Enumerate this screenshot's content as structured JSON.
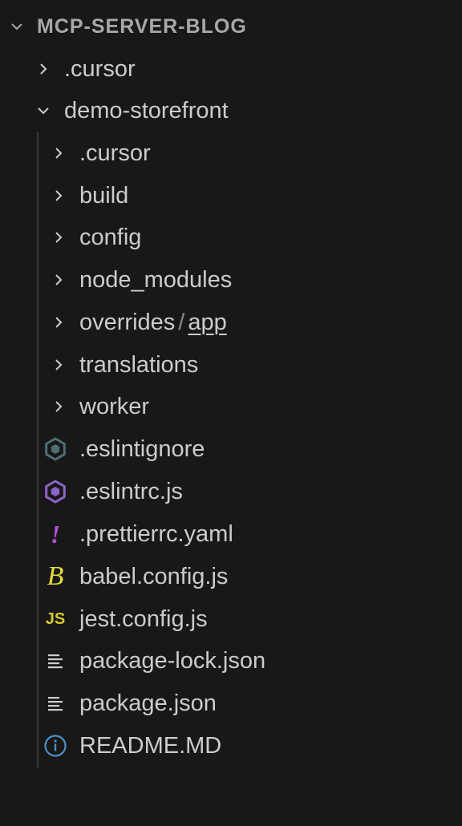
{
  "explorer": {
    "root": {
      "title": "MCP-SERVER-BLOG",
      "expanded": true
    },
    "items": [
      {
        "label": ".cursor",
        "type": "folder",
        "expanded": false
      },
      {
        "label": "demo-storefront",
        "type": "folder",
        "expanded": true
      }
    ],
    "children": [
      {
        "label": ".cursor",
        "type": "folder",
        "expanded": false
      },
      {
        "label": "build",
        "type": "folder",
        "expanded": false
      },
      {
        "label": "config",
        "type": "folder",
        "expanded": false
      },
      {
        "label": "node_modules",
        "type": "folder",
        "expanded": false
      },
      {
        "label": "overrides",
        "label_sep": "/",
        "label_suffix": "app",
        "type": "folder",
        "expanded": false
      },
      {
        "label": "translations",
        "type": "folder",
        "expanded": false
      },
      {
        "label": "worker",
        "type": "folder",
        "expanded": false
      },
      {
        "label": ".eslintignore",
        "type": "file",
        "icon": "eslint-ignore-icon"
      },
      {
        "label": ".eslintrc.js",
        "type": "file",
        "icon": "eslint-icon"
      },
      {
        "label": ".prettierrc.yaml",
        "type": "file",
        "icon": "prettier-icon",
        "glyph": "!"
      },
      {
        "label": "babel.config.js",
        "type": "file",
        "icon": "babel-icon",
        "glyph": "B"
      },
      {
        "label": "jest.config.js",
        "type": "file",
        "icon": "js-icon",
        "glyph": "JS"
      },
      {
        "label": "package-lock.json",
        "type": "file",
        "icon": "lines-icon"
      },
      {
        "label": "package.json",
        "type": "file",
        "icon": "lines-icon"
      },
      {
        "label": "README.MD",
        "type": "file",
        "icon": "info-icon"
      }
    ]
  },
  "colors": {
    "background": "#181818",
    "text": "#cccccc",
    "root_text": "#a8a8a8",
    "guide": "#3a3a3a",
    "eslint_purple": "#8e63c9",
    "eslint_gray": "#4f6e73",
    "prettier_purple": "#b052d6",
    "babel_yellow": "#e5da3a",
    "js_yellow": "#d6c833",
    "info_blue": "#4f8fc7"
  }
}
